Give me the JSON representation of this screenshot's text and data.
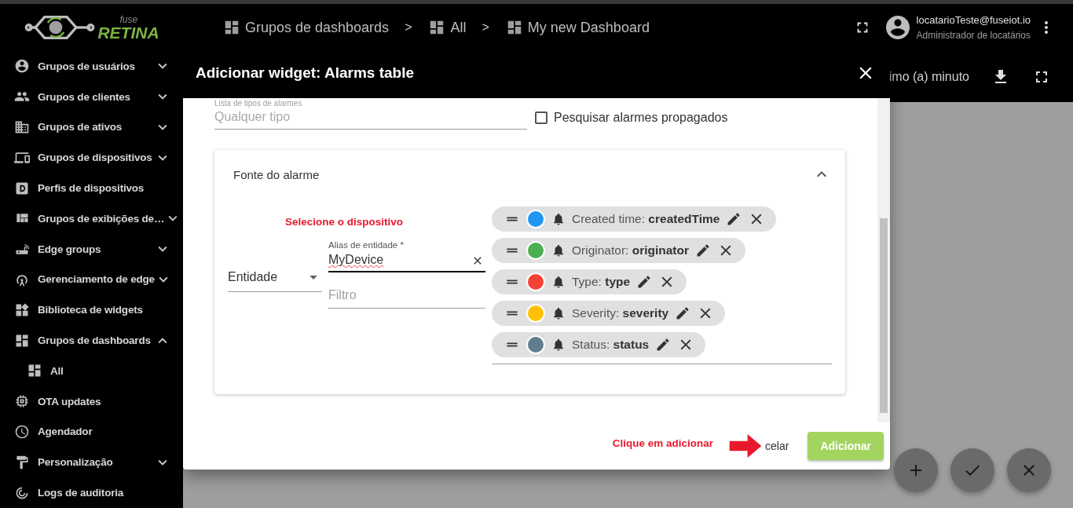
{
  "header": {
    "logo": {
      "small": "fuse",
      "name": "RETINA"
    },
    "breadcrumbs": [
      {
        "label": "Grupos de dashboards"
      },
      {
        "separator": ">",
        "label": "All"
      },
      {
        "separator": ">",
        "label": "My new Dashboard"
      }
    ],
    "user": {
      "email": "locatarioTeste@fuseiot.io",
      "role": "Administrador de locatários"
    }
  },
  "sidebar": {
    "items": [
      {
        "label": "Grupos de usuários",
        "expanded": false
      },
      {
        "label": "Grupos de clientes",
        "expanded": false
      },
      {
        "label": "Grupos de ativos",
        "expanded": false
      },
      {
        "label": "Grupos de dispositivos",
        "expanded": false
      },
      {
        "label": "Perfis de dispositivos"
      },
      {
        "label": "Grupos de exibições de…",
        "expanded": false
      },
      {
        "label": "Edge groups",
        "expanded": false
      },
      {
        "label": "Gerenciamento de edge",
        "expanded": false
      },
      {
        "label": "Biblioteca de widgets"
      },
      {
        "label": "Grupos de dashboards",
        "expanded": true,
        "children": [
          {
            "label": "All"
          }
        ]
      },
      {
        "label": "OTA updates"
      },
      {
        "label": "Agendador"
      },
      {
        "label": "Personalização",
        "expanded": false
      },
      {
        "label": "Logs de auditoria"
      }
    ]
  },
  "dashboard_toolbar": {
    "timewindow": "imo (a) minuto"
  },
  "dialog": {
    "title": "Adicionar widget: Alarms table",
    "alarm_types": {
      "label": "Lista de tipos de alarmes",
      "placeholder": "Qualquer tipo"
    },
    "propagated": {
      "label": "Pesquisar alarmes propagados",
      "checked": false
    },
    "source": {
      "title": "Fonte do alarme",
      "expanded": true,
      "annotation": "Selecione o dispositivo",
      "entity_type": {
        "value": "Entidade"
      },
      "alias": {
        "label": "Alias de entidade *",
        "value": "MyDevice"
      },
      "filter": {
        "placeholder": "Filtro"
      },
      "keys": [
        {
          "label": "Created time: **createdTime**",
          "color": "#2196f3"
        },
        {
          "label": "Originator: **originator**",
          "color": "#4caf50"
        },
        {
          "label": "Type: **type**",
          "color": "#f44336"
        },
        {
          "label": "Severity: **severity**",
          "color": "#ffc107"
        },
        {
          "label": "Status: **status**",
          "color": "#607d8b"
        }
      ]
    },
    "footer": {
      "annotation": "Clique em adicionar",
      "cancel": "celar",
      "add": "Adicionar"
    }
  },
  "fab_buttons": [
    {
      "kind": "add"
    },
    {
      "kind": "check"
    },
    {
      "kind": "close"
    }
  ]
}
